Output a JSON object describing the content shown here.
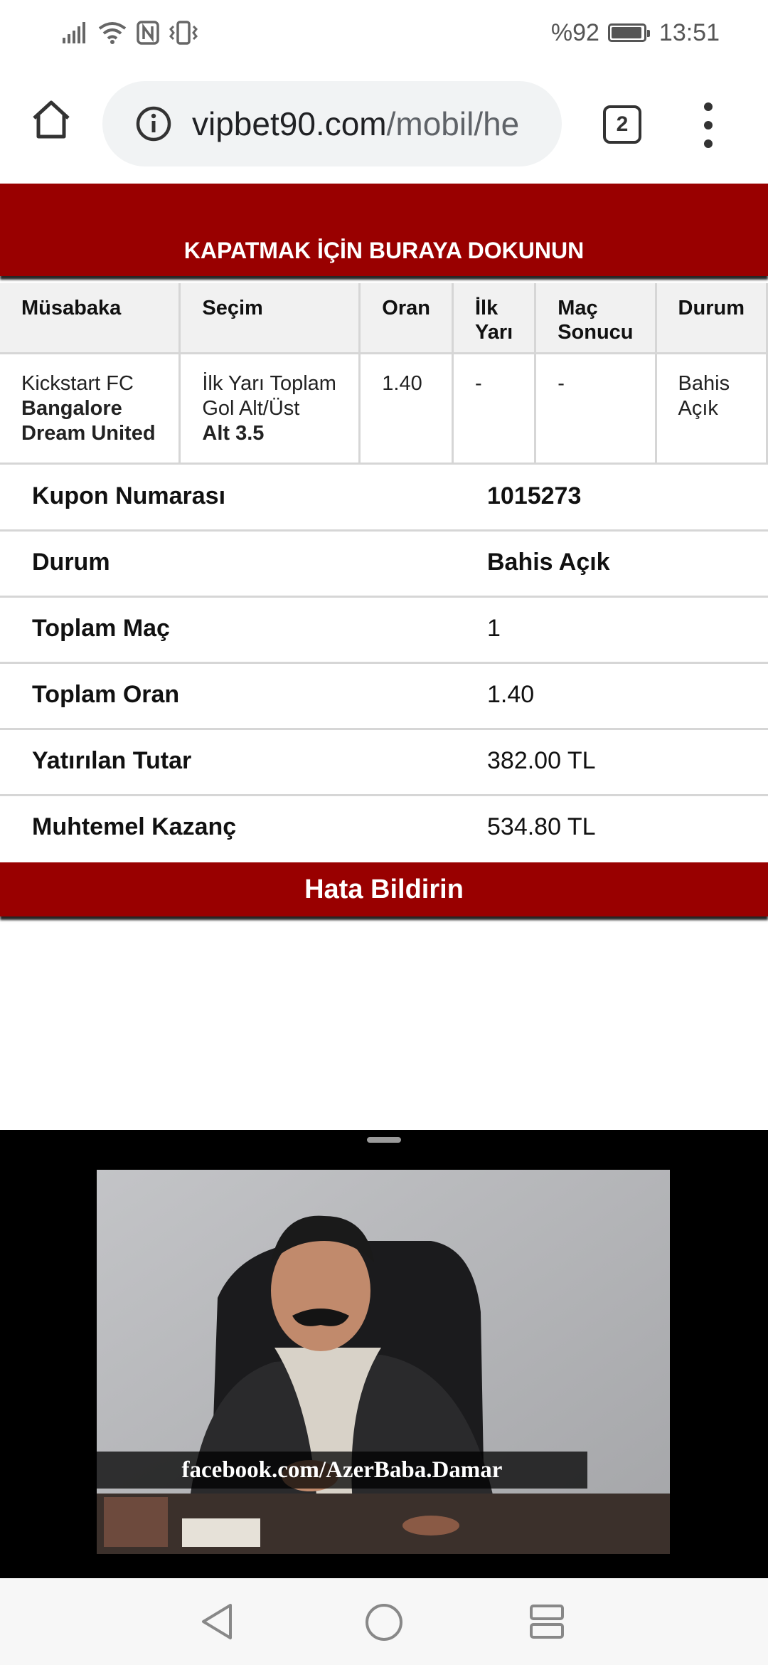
{
  "status_bar": {
    "battery_text": "%92",
    "time": "13:51",
    "icons": [
      "signal-icon",
      "wifi-icon",
      "nfc-icon",
      "vibrate-icon",
      "battery-icon"
    ]
  },
  "browser": {
    "url_domain": "vipbet90.com",
    "url_path": "/mobil/he",
    "tab_count": "2",
    "icons": [
      "home-icon",
      "info-icon",
      "tabs-icon",
      "more-vert-icon"
    ]
  },
  "close_banner": {
    "label": "KAPATMAK İÇİN BURAYA DOKUNUN",
    "color": "#990000"
  },
  "bet_table": {
    "headers": [
      "Müsabaka",
      "Seçim",
      "Oran",
      "İlk Yarı",
      "Maç Sonucu",
      "Durum"
    ],
    "header_lines": [
      [
        "Müsabaka"
      ],
      [
        "Seçim"
      ],
      [
        "Oran"
      ],
      [
        "İlk",
        "Yarı"
      ],
      [
        "Maç",
        "Sonucu"
      ],
      [
        "Durum"
      ]
    ],
    "row": {
      "match_team1": "Kickstart FC",
      "match_team2_line1": "Bangalore",
      "match_team2_line2": "Dream United",
      "selection_line1": "İlk Yarı Toplam",
      "selection_line2": "Gol Alt/Üst",
      "selection_value": "Alt 3.5",
      "odds": "1.40",
      "first_half": "-",
      "full_time": "-",
      "status_line1": "Bahis",
      "status_line2": "Açık"
    }
  },
  "summary": [
    {
      "label": "Kupon Numarası",
      "value": "1015273"
    },
    {
      "label": "Durum",
      "value": "Bahis Açık"
    },
    {
      "label": "Toplam Maç",
      "value": "1"
    },
    {
      "label": "Toplam Oran",
      "value": "1.40"
    },
    {
      "label": "Yatırılan Tutar",
      "value": "382.00 TL"
    },
    {
      "label": "Muhtemel Kazanç",
      "value": "534.80 TL"
    }
  ],
  "report_button": {
    "label": "Hata Bildirin"
  },
  "video": {
    "caption": "facebook.com/AzerBaba.Damar"
  },
  "nav_bar": {
    "icons": [
      "back-icon",
      "home-circle-icon",
      "recents-icon"
    ]
  }
}
